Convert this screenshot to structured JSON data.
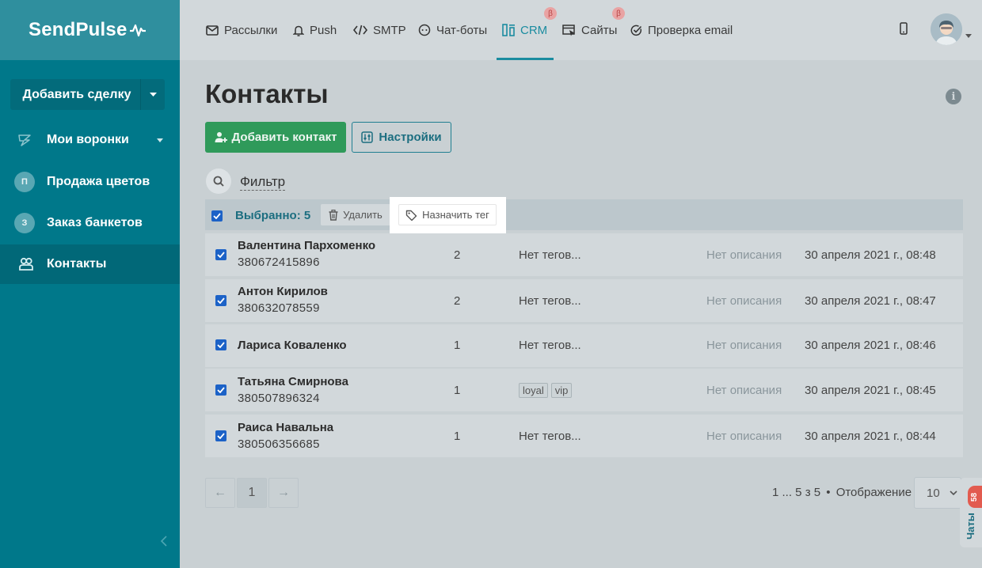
{
  "app": {
    "logo": "SendPulse"
  },
  "sidebar": {
    "add_deal_label": "Добавить сделку",
    "items": [
      {
        "label": "Мои воронки",
        "icon": "funnel-icon"
      },
      {
        "label": "Продажа цветов",
        "badge": "П"
      },
      {
        "label": "Заказ банкетов",
        "badge": "З"
      },
      {
        "label": "Контакты",
        "icon": "contacts-icon"
      }
    ]
  },
  "topnav": {
    "tabs": [
      {
        "label": "Рассылки",
        "icon": "envelope-icon"
      },
      {
        "label": "Push",
        "icon": "bell-icon"
      },
      {
        "label": "SMTP",
        "icon": "code-icon"
      },
      {
        "label": "Чат-боты",
        "icon": "chatbot-icon"
      },
      {
        "label": "CRM",
        "icon": "crm-icon",
        "beta": "β",
        "active": true
      },
      {
        "label": "Сайты",
        "icon": "site-icon",
        "beta": "β"
      },
      {
        "label": "Проверка email",
        "icon": "check-circle-icon"
      }
    ]
  },
  "page": {
    "title": "Контакты",
    "add_contact_label": "Добавить контакт",
    "settings_label": "Настройки",
    "filter_label": "Фильтр"
  },
  "selection": {
    "text": "Выбранно: 5",
    "delete_label": "Удалить",
    "assign_tag_label": "Назначить тег"
  },
  "contacts": [
    {
      "name": "Валентина Пархоменко",
      "phone": "380672415896",
      "count": "2",
      "tags_text": "Нет тегов...",
      "description": "Нет описания",
      "date": "30 апреля 2021 г., 08:48"
    },
    {
      "name": "Антон Кирилов",
      "phone": "380632078559",
      "count": "2",
      "tags_text": "Нет тегов...",
      "description": "Нет описания",
      "date": "30 апреля 2021 г., 08:47"
    },
    {
      "name": "Лариса Коваленко",
      "phone": "",
      "count": "1",
      "tags_text": "Нет тегов...",
      "description": "Нет описания",
      "date": "30 апреля 2021 г., 08:46"
    },
    {
      "name": "Татьяна Смирнова",
      "phone": "380507896324",
      "count": "1",
      "tags": [
        "loyal",
        "vip"
      ],
      "description": "Нет описания",
      "date": "30 апреля 2021 г., 08:45"
    },
    {
      "name": "Раиса Навальна",
      "phone": "380506356685",
      "count": "1",
      "tags_text": "Нет тегов...",
      "description": "Нет описания",
      "date": "30 апреля 2021 г., 08:44"
    }
  ],
  "pagination": {
    "prev": "←",
    "current": "1",
    "next": "→",
    "info": "1 ... 5 з 5",
    "separator": "•",
    "per_page_label": "Отображение",
    "per_page_value": "10"
  },
  "chats": {
    "label": "Чаты",
    "count": "58"
  },
  "colors": {
    "sidebar": "#00788a",
    "accent": "#1b8ca0",
    "primary_button": "#2f9a5a",
    "checkbox": "#1c62c7"
  }
}
